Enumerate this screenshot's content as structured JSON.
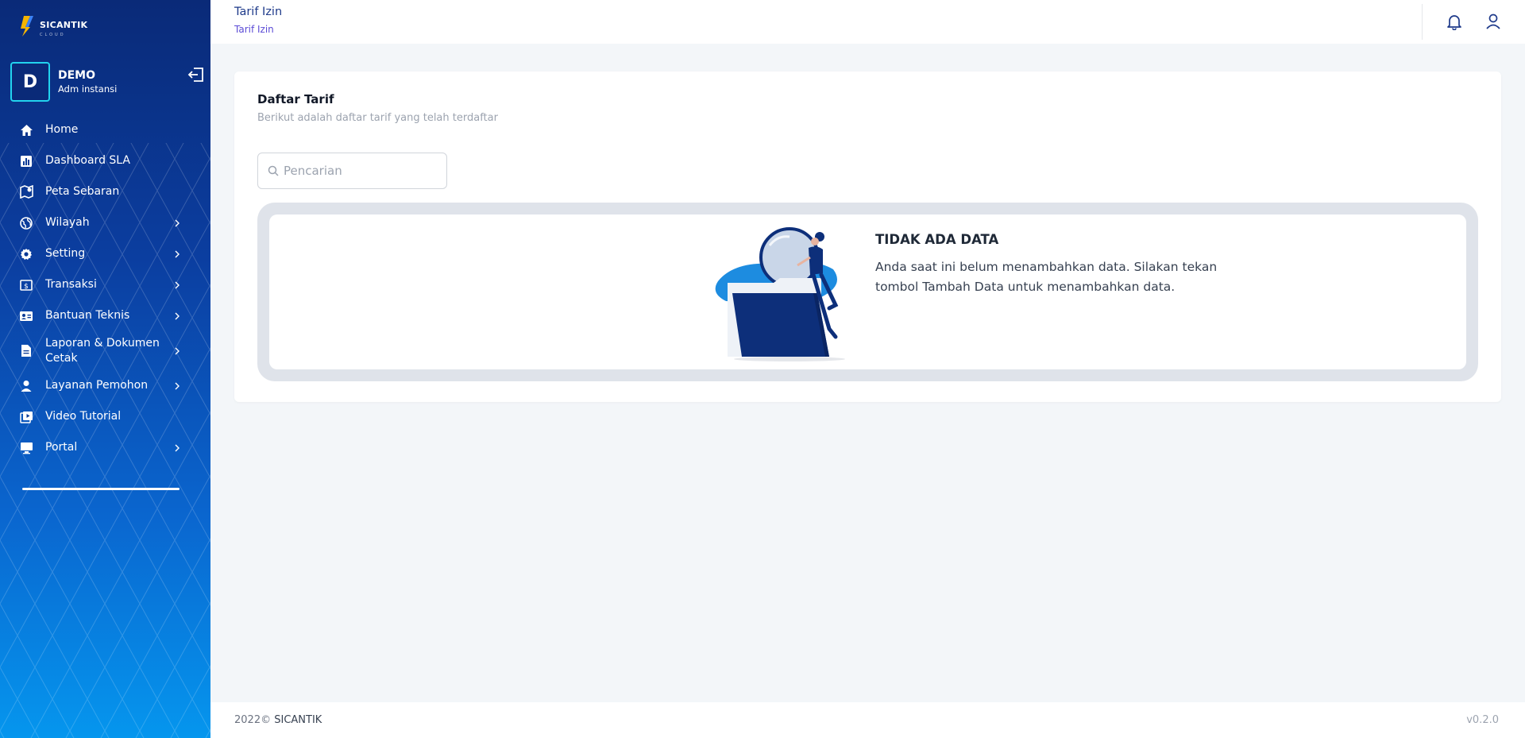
{
  "sidebar": {
    "logo": {
      "name": "SICANTIK",
      "sub": "CLOUD"
    },
    "user": {
      "initial": "D",
      "name": "DEMO",
      "role": "Adm instansi"
    },
    "items": [
      {
        "label": "Home",
        "icon": "home-icon",
        "submenu": false
      },
      {
        "label": "Dashboard SLA",
        "icon": "chart-icon",
        "submenu": false
      },
      {
        "label": "Peta Sebaran",
        "icon": "map-icon",
        "submenu": false
      },
      {
        "label": "Wilayah",
        "icon": "globe-icon",
        "submenu": true
      },
      {
        "label": "Setting",
        "icon": "gear-icon",
        "submenu": true
      },
      {
        "label": "Transaksi",
        "icon": "money-icon",
        "submenu": true
      },
      {
        "label": "Bantuan Teknis",
        "icon": "id-card-icon",
        "submenu": true
      },
      {
        "label": "Laporan & Dokumen Cetak",
        "icon": "document-icon",
        "submenu": true
      },
      {
        "label": "Layanan Pemohon",
        "icon": "person-icon",
        "submenu": true
      },
      {
        "label": "Video Tutorial",
        "icon": "video-icon",
        "submenu": false
      },
      {
        "label": "Portal",
        "icon": "monitor-icon",
        "submenu": true
      }
    ]
  },
  "header": {
    "title": "Tarif Izin",
    "breadcrumb": "Tarif Izin"
  },
  "main": {
    "card_title": "Daftar Tarif",
    "card_subtitle": "Berikut adalah daftar tarif yang telah terdaftar",
    "search": {
      "placeholder": "Pencarian"
    },
    "empty": {
      "title": "TIDAK ADA DATA",
      "description": "Anda saat ini belum menambahkan data. Silakan tekan tombol Tambah Data untuk menambahkan data."
    }
  },
  "footer": {
    "year": "2022©",
    "brand": "SICANTIK",
    "version": "v0.2.0"
  },
  "colors": {
    "sidebar_top": "#0a2a78",
    "sidebar_bottom": "#0596ee",
    "accent": "#1e3a8a",
    "breadcrumb": "#5b4bd6"
  }
}
